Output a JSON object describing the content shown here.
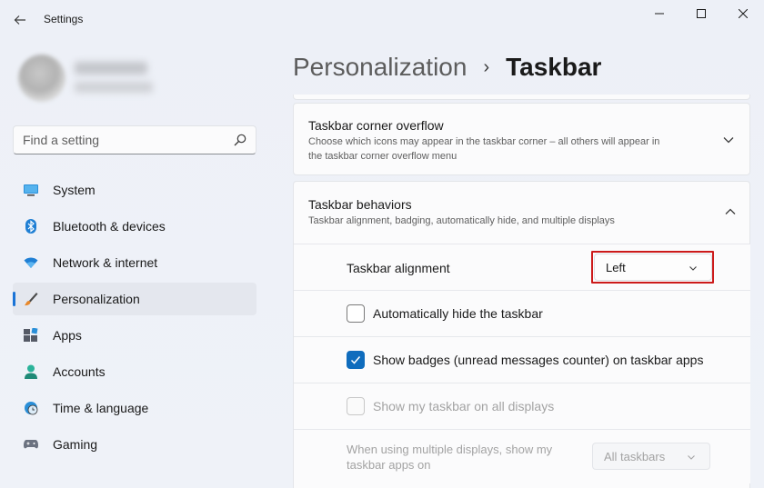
{
  "window": {
    "title": "Settings"
  },
  "sidebar": {
    "search_placeholder": "Find a setting",
    "items": [
      {
        "label": "System",
        "icon": "monitor-icon"
      },
      {
        "label": "Bluetooth & devices",
        "icon": "bluetooth-icon"
      },
      {
        "label": "Network & internet",
        "icon": "wifi-icon"
      },
      {
        "label": "Personalization",
        "icon": "brush-icon",
        "active": true
      },
      {
        "label": "Apps",
        "icon": "apps-icon"
      },
      {
        "label": "Accounts",
        "icon": "person-icon"
      },
      {
        "label": "Time & language",
        "icon": "globe-clock-icon"
      },
      {
        "label": "Gaming",
        "icon": "gamepad-icon"
      }
    ]
  },
  "breadcrumb": {
    "parent": "Personalization",
    "separator": "›",
    "current": "Taskbar"
  },
  "cards": {
    "corner_overflow": {
      "title": "Taskbar corner overflow",
      "description_line1": "Choose which icons may appear in the taskbar corner – all others will appear in",
      "description_line2": "the taskbar corner overflow menu",
      "expanded": false
    },
    "behaviors": {
      "title": "Taskbar behaviors",
      "description": "Taskbar alignment, badging, automatically hide, and multiple displays",
      "expanded": true,
      "alignment": {
        "label": "Taskbar alignment",
        "value": "Left",
        "highlighted": true
      },
      "auto_hide": {
        "label": "Automatically hide the taskbar",
        "checked": false
      },
      "badges": {
        "label": "Show badges (unread messages counter) on taskbar apps",
        "checked": true
      },
      "all_displays": {
        "label": "Show my taskbar on all displays",
        "checked": false,
        "disabled": true
      },
      "multi_display": {
        "label_line1": "When using multiple displays, show my",
        "label_line2": "taskbar apps on",
        "value": "All taskbars",
        "disabled": true
      }
    }
  },
  "colors": {
    "accent": "#0f6cbd",
    "nav_indicator": "#1a73d6",
    "highlight_box": "#cc1a1a"
  }
}
